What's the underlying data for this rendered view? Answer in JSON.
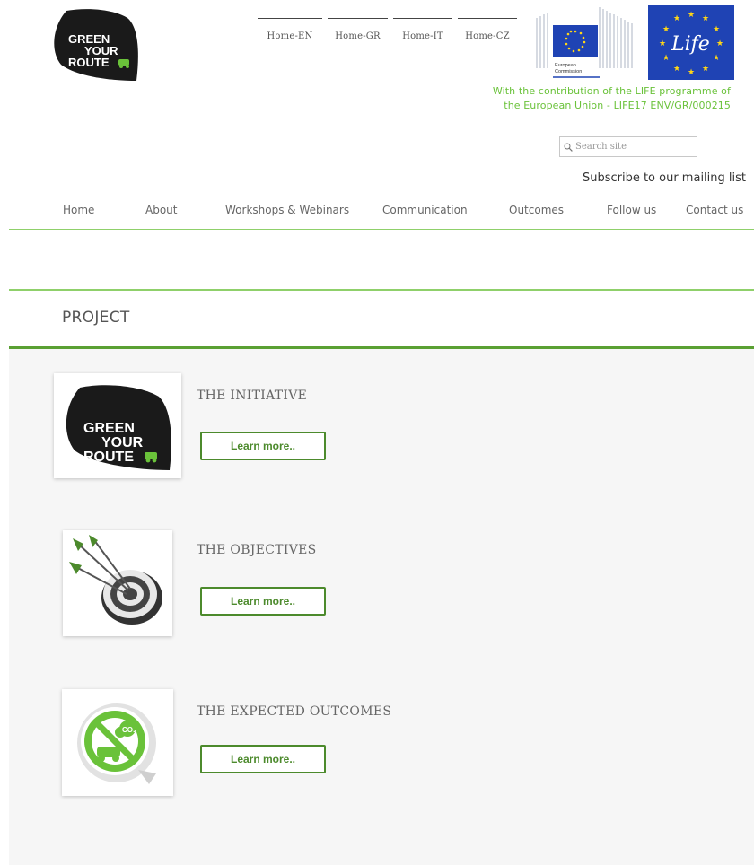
{
  "header": {
    "logo": {
      "line1": "GREEN",
      "line2": "YOUR",
      "line3": "ROUTE",
      "icon": "car-icon"
    },
    "language_links": [
      "Home-EN",
      "Home-GR",
      "Home-IT",
      "Home-CZ"
    ],
    "ec_logo": {
      "line1": "European",
      "line2": "Commission"
    },
    "life_logo": {
      "text": "Life"
    },
    "contribution": {
      "line1": "With the contribution of the LIFE programme of",
      "line2": "the European Union - LIFE17 ENV/GR/000215"
    },
    "search": {
      "placeholder": "Search site",
      "icon": "search-icon"
    },
    "subscribe_label": "Subscribe to our mailing list"
  },
  "nav": {
    "items": [
      "Home",
      "About",
      "Workshops & Webinars",
      "Communication",
      "Outcomes",
      "Follow us",
      "Contact us"
    ]
  },
  "page": {
    "title": "PROJECT"
  },
  "cards": [
    {
      "title": "THE INITIATIVE",
      "button": "Learn more..",
      "icon": "green-your-route-logo"
    },
    {
      "title": "THE OBJECTIVES",
      "button": "Learn more..",
      "icon": "target-arrows-icon"
    },
    {
      "title": "THE EXPECTED OUTCOMES",
      "button": "Learn more..",
      "icon": "no-co2-car-icon"
    }
  ],
  "colors": {
    "brand_green": "#6ac23a",
    "button_green": "#4c8a2c",
    "nav_rule": "#8fd06a",
    "eu_blue": "#1f43b4",
    "logo_dark": "#1a1a1a"
  }
}
